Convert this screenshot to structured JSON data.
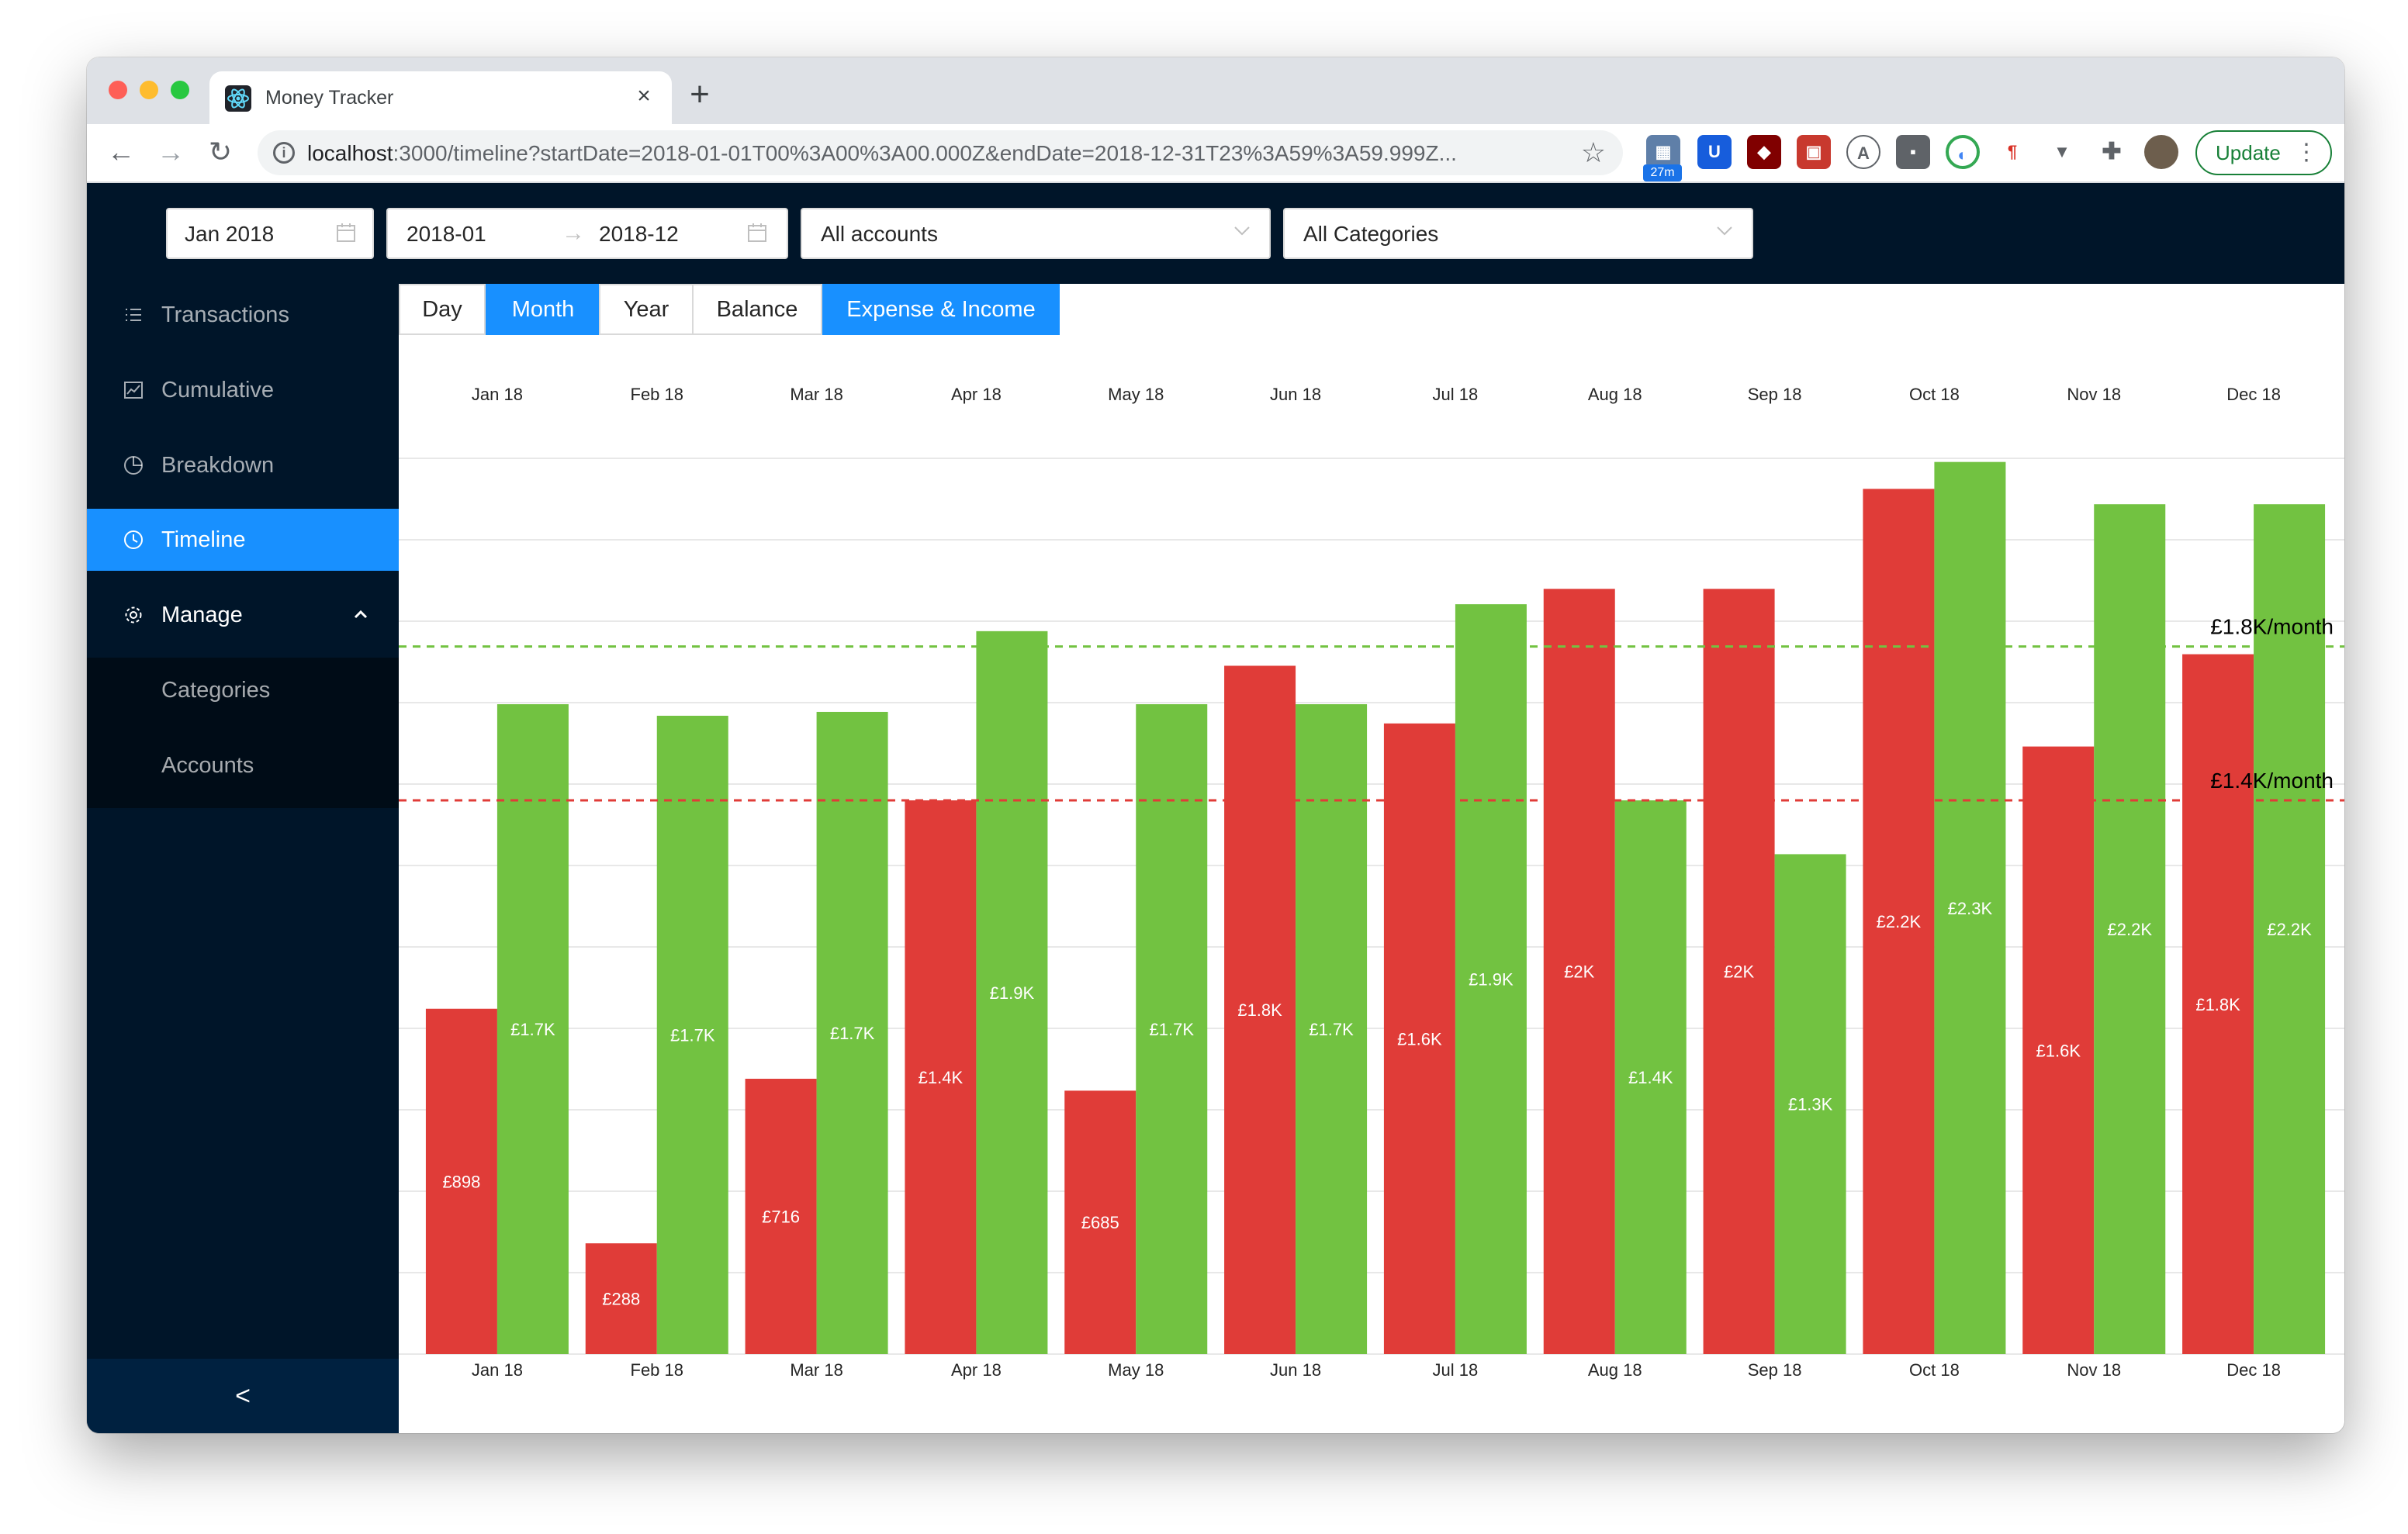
{
  "browser": {
    "tab_title": "Money Tracker",
    "url_host": "localhost",
    "url_rest": ":3000/timeline?startDate=2018-01-01T00%3A00%3A00.000Z&endDate=2018-12-31T23%3A59%3A59.999Z...",
    "ext_badge": "27m",
    "update_label": "Update"
  },
  "filters": {
    "month_picker": "Jan 2018",
    "range_start": "2018-01",
    "range_end": "2018-12",
    "accounts": "All accounts",
    "categories": "All Categories"
  },
  "sidebar": {
    "items": [
      {
        "label": "Transactions",
        "icon": "list-icon"
      },
      {
        "label": "Cumulative",
        "icon": "line-chart-icon"
      },
      {
        "label": "Breakdown",
        "icon": "pie-chart-icon"
      },
      {
        "label": "Timeline",
        "icon": "clock-icon",
        "active": true
      },
      {
        "label": "Manage",
        "icon": "gear-icon"
      }
    ],
    "subitems": [
      {
        "label": "Categories"
      },
      {
        "label": "Accounts"
      }
    ],
    "collapse_label": "<"
  },
  "view_modes": [
    {
      "label": "Day",
      "checked": false
    },
    {
      "label": "Month",
      "checked": true
    },
    {
      "label": "Year",
      "checked": false
    },
    {
      "label": "Balance",
      "checked": false
    },
    {
      "label": "Expense & Income",
      "checked": true
    }
  ],
  "colors": {
    "expense": "#e03c38",
    "income": "#72c241",
    "accent": "#1890ff",
    "sidebar_bg": "#001529"
  },
  "chart_data": {
    "type": "bar",
    "categories": [
      "Jan 18",
      "Feb 18",
      "Mar 18",
      "Apr 18",
      "May 18",
      "Jun 18",
      "Jul 18",
      "Aug 18",
      "Sep 18",
      "Oct 18",
      "Nov 18",
      "Dec 18"
    ],
    "series": [
      {
        "values": [
          898,
          288,
          716,
          1440,
          685,
          1790,
          1640,
          1990,
          1990,
          2250,
          1580,
          1820
        ],
        "labels": [
          "£898",
          "£288",
          "£716",
          "£1.4K",
          "£685",
          "£1.8K",
          "£1.6K",
          "£2K",
          "£2K",
          "£2.2K",
          "£1.6K",
          "£1.8K"
        ],
        "color": "#e03c38"
      },
      {
        "values": [
          1690,
          1660,
          1670,
          1880,
          1690,
          1690,
          1950,
          1440,
          1300,
          2320,
          2210,
          2210
        ],
        "labels": [
          "£1.7K",
          "£1.7K",
          "£1.7K",
          "£1.9K",
          "£1.7K",
          "£1.7K",
          "£1.9K",
          "£1.4K",
          "£1.3K",
          "£2.3K",
          "£2.2K",
          "£2.2K"
        ],
        "color": "#72c241"
      }
    ],
    "reference_lines": [
      {
        "value": 1840,
        "label": "£1.8K/month",
        "color": "#72c241"
      },
      {
        "value": 1440,
        "label": "£1.4K/month",
        "color": "#e03c38"
      }
    ],
    "ylim": [
      0,
      2400
    ],
    "grid": true
  }
}
